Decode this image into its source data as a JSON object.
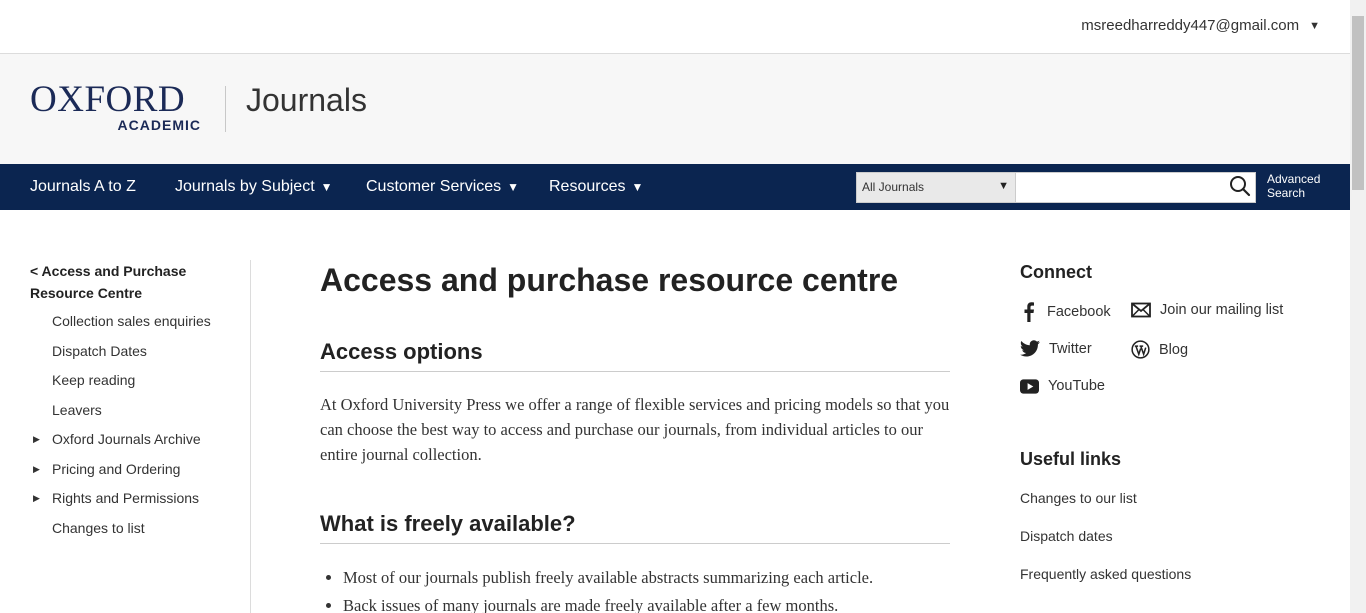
{
  "user": {
    "email": "msreedharreddy447@gmail.com",
    "caret": "▼"
  },
  "brand": {
    "line1": "OXFORD",
    "line2": "ACADEMIC",
    "site": "Journals"
  },
  "nav": {
    "items": [
      {
        "label": "Journals A to Z",
        "caret": ""
      },
      {
        "label": "Journals by Subject",
        "caret": "▼"
      },
      {
        "label": "Customer Services",
        "caret": "▼"
      },
      {
        "label": "Resources",
        "caret": "▼"
      }
    ],
    "search_scope": "All Journals",
    "search_value": "",
    "advanced_search": [
      "Advanced",
      "Search"
    ]
  },
  "sidenav": {
    "back": "< Access and Purchase Resource Centre",
    "items": [
      {
        "label": "Collection sales enquiries",
        "expandable": false
      },
      {
        "label": "Dispatch Dates",
        "expandable": false
      },
      {
        "label": "Keep reading",
        "expandable": false
      },
      {
        "label": "Leavers",
        "expandable": false
      },
      {
        "label": "Oxford Journals Archive",
        "expandable": true
      },
      {
        "label": "Pricing and Ordering",
        "expandable": true
      },
      {
        "label": "Rights and Permissions",
        "expandable": true
      },
      {
        "label": "Changes to list",
        "expandable": false
      }
    ],
    "expand_glyph": "▶"
  },
  "main": {
    "title": "Access and purchase resource centre",
    "section1_heading": "Access options",
    "section1_body": "At Oxford University Press we offer a range of flexible services and pricing models so that you can choose the best way to access and purchase our journals, from individual articles to our entire journal collection.",
    "section2_heading": "What is freely available?",
    "bullets": [
      "Most of our journals publish freely available abstracts summarizing each article.",
      "Back issues of many journals are made freely available after a few months."
    ]
  },
  "connect": {
    "heading": "Connect",
    "links": [
      {
        "label": "Facebook",
        "icon": "facebook-icon"
      },
      {
        "label": "Join our mailing list",
        "icon": "mail-icon"
      },
      {
        "label": "Twitter",
        "icon": "twitter-icon"
      },
      {
        "label": "Blog",
        "icon": "wordpress-icon"
      },
      {
        "label": "YouTube",
        "icon": "youtube-icon"
      }
    ]
  },
  "useful_links": {
    "heading": "Useful links",
    "items": [
      "Changes to our list",
      "Dispatch dates",
      "Frequently asked questions"
    ]
  },
  "colors": {
    "nav_bg": "#0b2550",
    "brand": "#1b2a57",
    "masthead_bg": "#f7f7f7"
  }
}
